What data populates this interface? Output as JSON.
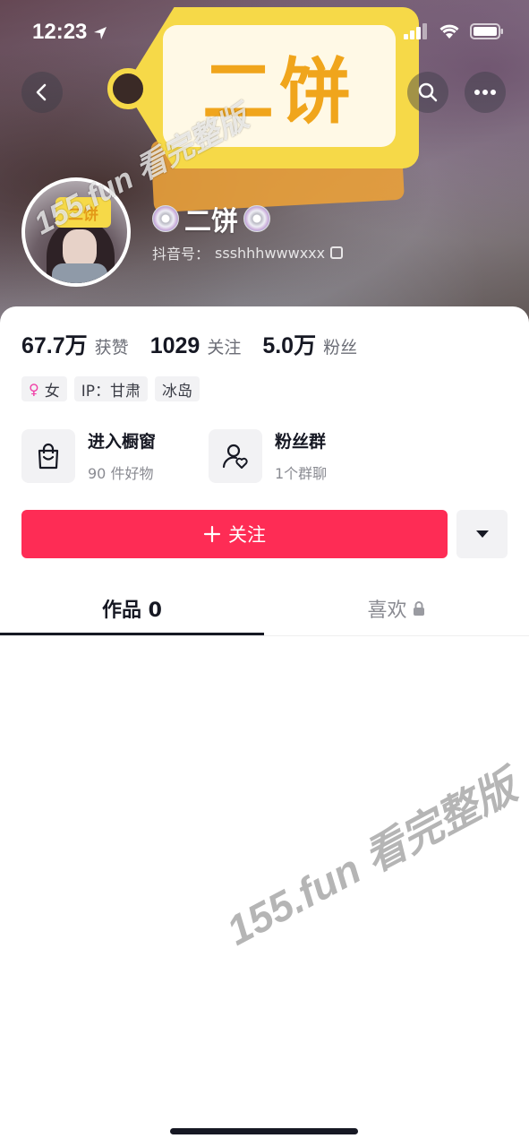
{
  "status_bar": {
    "time": "12:23"
  },
  "banner": {
    "tag_text": "二饼"
  },
  "profile": {
    "avatar_tag": "二饼",
    "name": "二饼",
    "id_label": "抖音号：",
    "id_value": "ssshhhwwwxxx"
  },
  "stats": [
    {
      "value": "67.7万",
      "label": "获赞"
    },
    {
      "value": "1029",
      "label": "关注"
    },
    {
      "value": "5.0万",
      "label": "粉丝"
    }
  ],
  "chips": [
    {
      "icon": "female-icon",
      "label": "女"
    },
    {
      "label": "IP：甘肃"
    },
    {
      "label": "冰岛"
    }
  ],
  "shortcuts": {
    "shop": {
      "icon": "shopping-bag-icon",
      "title": "进入橱窗",
      "subtitle": "90 件好物"
    },
    "fans": {
      "icon": "fan-group-icon",
      "title": "粉丝群",
      "subtitle": "1个群聊"
    }
  },
  "actions": {
    "follow_label": "关注",
    "accent": "#fe2c55"
  },
  "tabs": [
    {
      "label": "作品 0",
      "active": true
    },
    {
      "label": "喜欢",
      "icon": "lock-icon"
    }
  ],
  "watermark": {
    "text": "155.fun 看完整版"
  }
}
